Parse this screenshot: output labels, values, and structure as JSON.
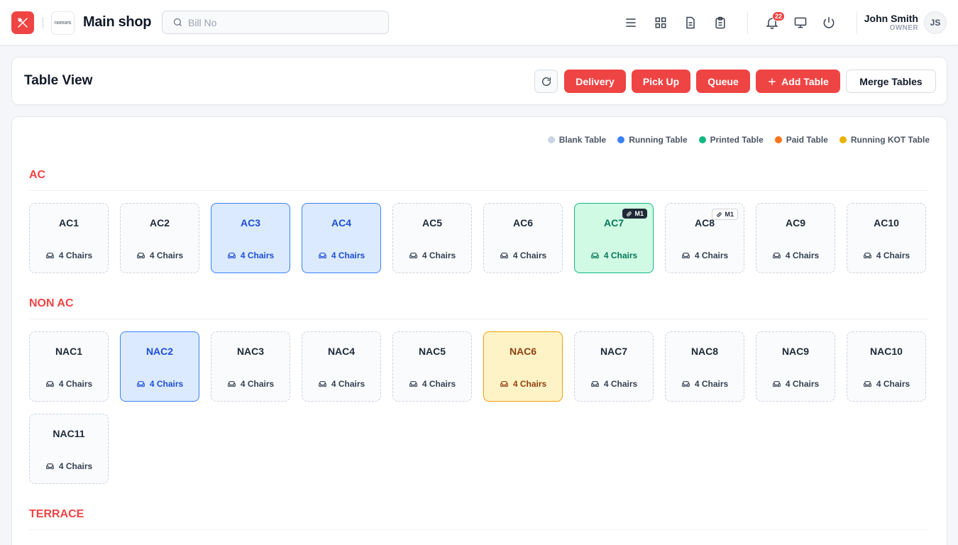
{
  "header": {
    "shop_logo_text": "nomors",
    "shop_name": "Main shop",
    "search_placeholder": "Bill No",
    "notification_count": "22",
    "user_name": "John Smith",
    "user_role": "OWNER",
    "user_initials": "JS"
  },
  "toolbar": {
    "title": "Table View",
    "delivery": "Delivery",
    "pickup": "Pick Up",
    "queue": "Queue",
    "add_table": "Add Table",
    "merge_tables": "Merge Tables"
  },
  "legend": [
    {
      "label": "Blank Table",
      "color": "#cbd5e1"
    },
    {
      "label": "Running Table",
      "color": "#3b82f6"
    },
    {
      "label": "Printed Table",
      "color": "#10b981"
    },
    {
      "label": "Paid Table",
      "color": "#f97316"
    },
    {
      "label": "Running KOT Table",
      "color": "#eab308"
    }
  ],
  "sections": [
    {
      "name": "AC",
      "tables": [
        {
          "name": "AC1",
          "chairs": "4 Chairs",
          "status": "blank"
        },
        {
          "name": "AC2",
          "chairs": "4 Chairs",
          "status": "blank"
        },
        {
          "name": "AC3",
          "chairs": "4 Chairs",
          "status": "running"
        },
        {
          "name": "AC4",
          "chairs": "4 Chairs",
          "status": "running"
        },
        {
          "name": "AC5",
          "chairs": "4 Chairs",
          "status": "blank"
        },
        {
          "name": "AC6",
          "chairs": "4 Chairs",
          "status": "blank"
        },
        {
          "name": "AC7",
          "chairs": "4 Chairs",
          "status": "printed",
          "merge": "M1",
          "merge_style": "dark"
        },
        {
          "name": "AC8",
          "chairs": "4 Chairs",
          "status": "blank",
          "merge": "M1",
          "merge_style": "light"
        },
        {
          "name": "AC9",
          "chairs": "4 Chairs",
          "status": "blank"
        },
        {
          "name": "AC10",
          "chairs": "4 Chairs",
          "status": "blank"
        }
      ]
    },
    {
      "name": "NON AC",
      "tables": [
        {
          "name": "NAC1",
          "chairs": "4 Chairs",
          "status": "blank"
        },
        {
          "name": "NAC2",
          "chairs": "4 Chairs",
          "status": "running"
        },
        {
          "name": "NAC3",
          "chairs": "4 Chairs",
          "status": "blank"
        },
        {
          "name": "NAC4",
          "chairs": "4 Chairs",
          "status": "blank"
        },
        {
          "name": "NAC5",
          "chairs": "4 Chairs",
          "status": "blank"
        },
        {
          "name": "NAC6",
          "chairs": "4 Chairs",
          "status": "kot"
        },
        {
          "name": "NAC7",
          "chairs": "4 Chairs",
          "status": "blank"
        },
        {
          "name": "NAC8",
          "chairs": "4 Chairs",
          "status": "blank"
        },
        {
          "name": "NAC9",
          "chairs": "4 Chairs",
          "status": "blank"
        },
        {
          "name": "NAC10",
          "chairs": "4 Chairs",
          "status": "blank"
        },
        {
          "name": "NAC11",
          "chairs": "4 Chairs",
          "status": "blank"
        }
      ]
    },
    {
      "name": "TERRACE",
      "tables": []
    }
  ]
}
